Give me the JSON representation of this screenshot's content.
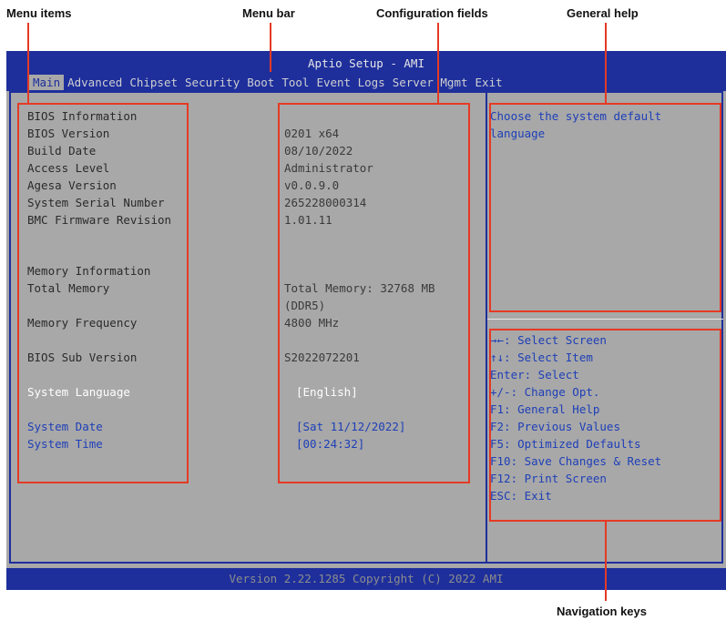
{
  "callouts": {
    "menu_items": "Menu items",
    "menu_bar": "Menu bar",
    "configuration_fields": "Configuration fields",
    "general_help": "General help",
    "navigation_keys": "Navigation keys"
  },
  "bios": {
    "title": "Aptio Setup - AMI",
    "menu": [
      "Main",
      "Advanced",
      "Chipset",
      "Security",
      "Boot",
      "Tool",
      "Event Logs",
      "Server Mgmt",
      "Exit"
    ],
    "active_menu": "Main",
    "labels": {
      "bios_info": "BIOS Information",
      "bios_version": "BIOS Version",
      "build_date": "Build Date",
      "access_level": "Access Level",
      "agesa_version": "Agesa Version",
      "serial": "System Serial Number",
      "bmc": "BMC Firmware Revision",
      "memory_info": "Memory Information",
      "total_memory": "Total Memory",
      "memory_freq": "Memory Frequency",
      "sub_version": "BIOS Sub Version",
      "language": "System Language",
      "date": "System Date",
      "time": "System Time"
    },
    "values": {
      "bios_version": "0201 x64",
      "build_date": "08/10/2022",
      "access_level": "Administrator",
      "agesa_version": "v0.0.9.0",
      "serial": "265228000314",
      "bmc": "1.01.11",
      "total_memory_1": "Total Memory: 32768 MB",
      "total_memory_2": "(DDR5)",
      "memory_freq": "4800 MHz",
      "sub_version": "S2022072201",
      "language": "[English]",
      "date": "[Sat 11/12/2022]",
      "time": "[00:24:32]"
    },
    "help_text": "Choose the system default\nlanguage",
    "nav_keys": [
      "→←: Select Screen",
      "↑↓: Select Item",
      "Enter: Select",
      "+/-: Change Opt.",
      "F1: General Help",
      "F2: Previous Values",
      "F5: Optimized Defaults",
      "F10: Save Changes & Reset",
      "F12: Print Screen",
      "ESC: Exit"
    ],
    "version": "Version 2.22.1285 Copyright (C) 2022 AMI"
  },
  "colors": {
    "bios_blue": "#1e2f9c",
    "bios_gray": "#a8a8a8",
    "callout_red": "#e53a24"
  }
}
